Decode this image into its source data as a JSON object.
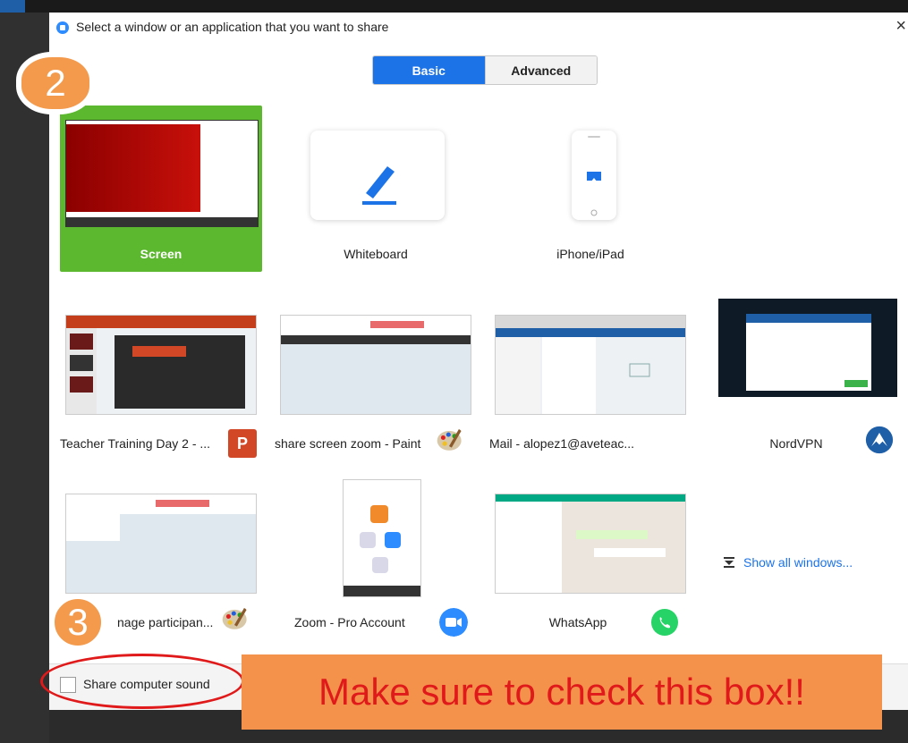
{
  "dialog": {
    "title": "Select a window or an application that you want to share",
    "close_glyph": "×"
  },
  "tabs": [
    {
      "label": "Basic",
      "active": true
    },
    {
      "label": "Advanced",
      "active": false
    }
  ],
  "tiles": {
    "screen": "Screen",
    "whiteboard": "Whiteboard",
    "iphone": "iPhone/iPad",
    "ppt": "Teacher Training Day 2 - ...",
    "paint": "share screen zoom - Paint",
    "mail": "Mail - alopez1@aveteac...",
    "nordvpn": "NordVPN",
    "paint2": "nage participan...",
    "zoom": "Zoom - Pro Account",
    "whatsapp": "WhatsApp",
    "show_all": "Show all windows..."
  },
  "footer": {
    "share_sound_label": "Share computer sound",
    "share_sound_checked": false
  },
  "annotations": {
    "callout_2": "2",
    "callout_3": "3",
    "banner": "Make sure to check this box!!"
  },
  "icons": {
    "ppt_letter": "P"
  },
  "colors": {
    "accent": "#1c73e8",
    "screen_tile": "#5cb82e",
    "banner_bg": "#f4914b",
    "banner_text": "#e01a1a",
    "callout": "#f39a4c"
  }
}
